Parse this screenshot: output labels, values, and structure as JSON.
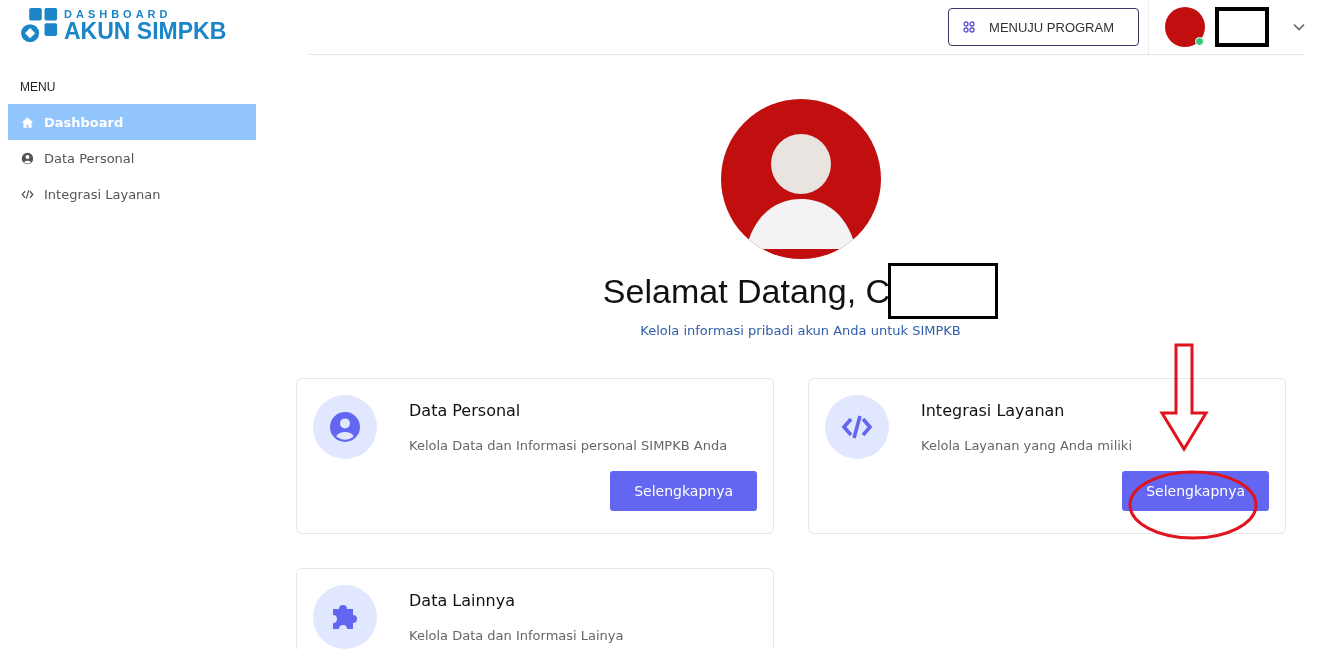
{
  "logo": {
    "top": "DASHBOARD",
    "main": "AKUN SIMPKB"
  },
  "header": {
    "program_button": "MENUJU PROGRAM",
    "user_online": true
  },
  "sidebar": {
    "heading": "MENU",
    "items": [
      {
        "label": "Dashboard",
        "kind": "home",
        "selected": true
      },
      {
        "label": "Data Personal",
        "kind": "user",
        "selected": false
      },
      {
        "label": "Integrasi Layanan",
        "kind": "code",
        "selected": false
      }
    ]
  },
  "welcome": {
    "title": "Selamat Datang, C",
    "subtitle": "Kelola informasi pribadi akun Anda untuk SIMPKB"
  },
  "cards": [
    {
      "kind": "user",
      "title": "Data Personal",
      "description": "Kelola Data dan Informasi personal SIMPKB Anda",
      "button": "Selengkapnya",
      "highlighted": false
    },
    {
      "kind": "code",
      "title": "Integrasi Layanan",
      "description": "Kelola Layanan yang Anda miliki",
      "button": "Selengkapnya",
      "highlighted": true
    },
    {
      "kind": "puzzle",
      "title": "Data Lainnya",
      "description": "Kelola Data dan Informasi Lainya",
      "highlighted": false
    }
  ]
}
